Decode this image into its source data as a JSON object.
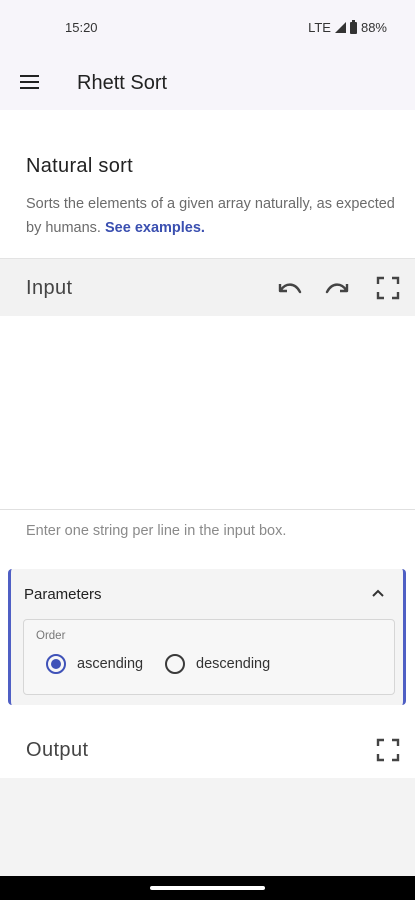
{
  "status_bar": {
    "time": "15:20",
    "network": "LTE",
    "battery": "88%"
  },
  "app_bar": {
    "title": "Rhett Sort"
  },
  "intro": {
    "title": "Natural sort",
    "description": "Sorts the elements of a given array naturally, as expected by humans.",
    "link_text": "See examples."
  },
  "input": {
    "label": "Input",
    "value": "",
    "hint": "Enter one string per line in the input box."
  },
  "parameters": {
    "title": "Parameters",
    "order_legend": "Order",
    "options": [
      {
        "label": "ascending",
        "checked": true
      },
      {
        "label": "descending",
        "checked": false
      }
    ]
  },
  "output": {
    "label": "Output"
  },
  "colors": {
    "accent": "#3f52b8",
    "panel_border": "#4f5fc4",
    "link": "#3a4fb0"
  }
}
